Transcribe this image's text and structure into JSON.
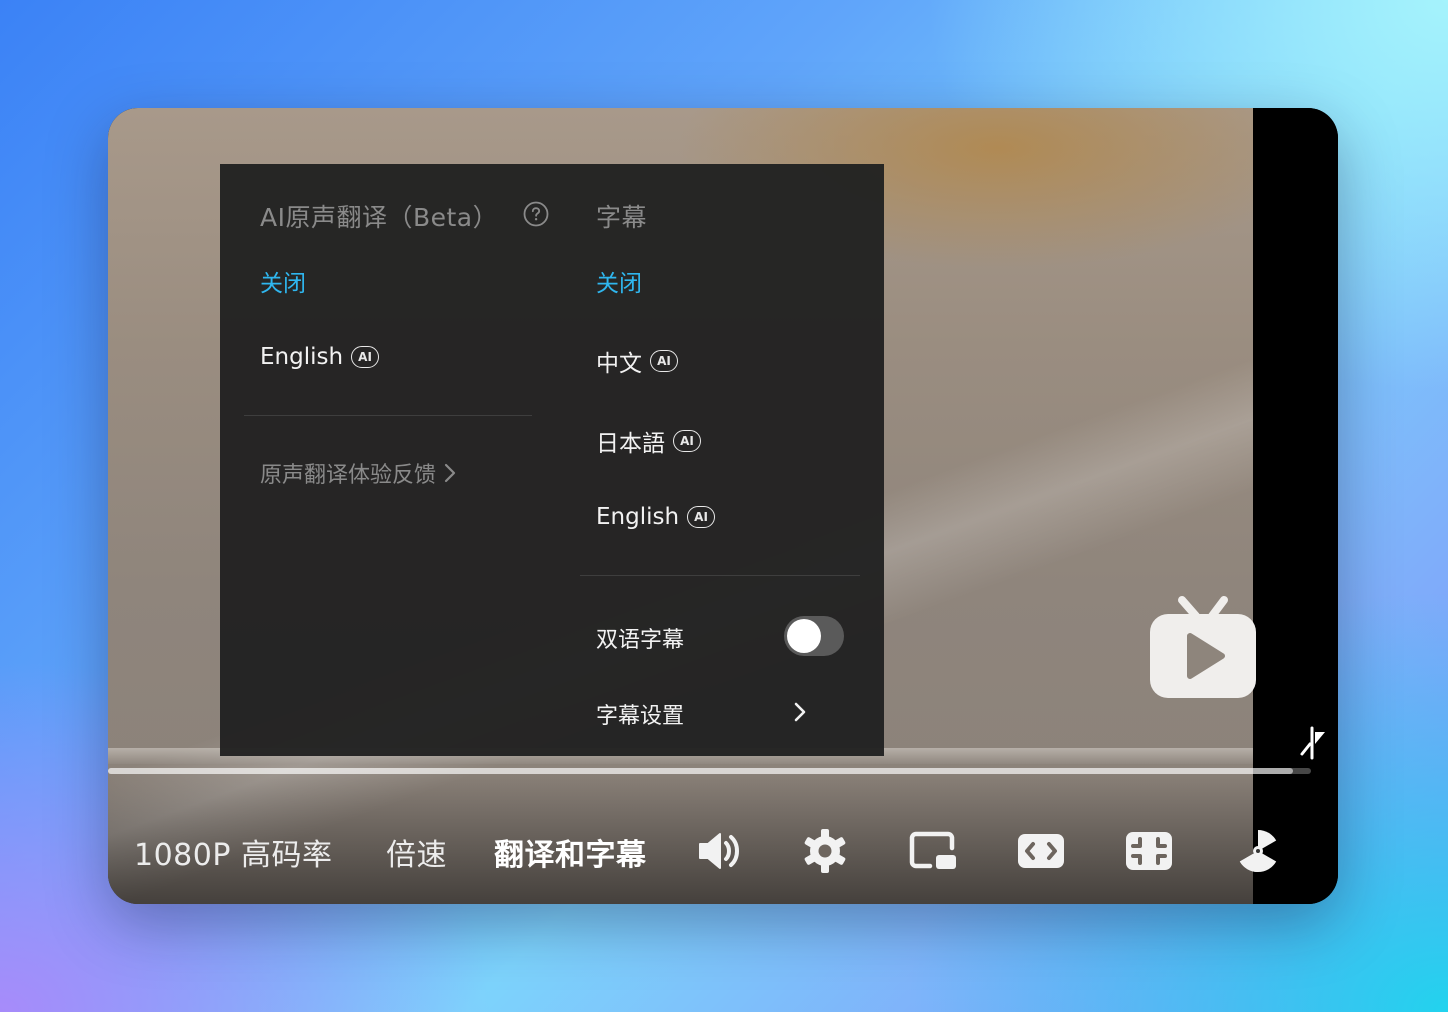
{
  "menu": {
    "ai_translate": {
      "title": "AI原声翻译（Beta）",
      "options": [
        {
          "label": "关闭",
          "active": true,
          "ai": false
        },
        {
          "label": "English",
          "active": false,
          "ai": true
        }
      ],
      "feedback_label": "原声翻译体验反馈"
    },
    "subtitles": {
      "title": "字幕",
      "options": [
        {
          "label": "关闭",
          "active": true,
          "ai": false
        },
        {
          "label": "中文",
          "active": false,
          "ai": true
        },
        {
          "label": "日本語",
          "active": false,
          "ai": true
        },
        {
          "label": "English",
          "active": false,
          "ai": true
        }
      ],
      "bilingual_label": "双语字幕",
      "bilingual_enabled": false,
      "settings_label": "字幕设置"
    },
    "ai_badge_text": "AI"
  },
  "controls": {
    "quality_label": "1080P 高码率",
    "speed_label": "倍速",
    "translate_subtitle_label": "翻译和字幕"
  },
  "progress": {
    "fraction_played": 0.985
  },
  "colors": {
    "accent": "#2fb6ee",
    "menu_bg": "#222222",
    "muted_text": "#8a8a8a"
  },
  "icons": [
    "help-icon",
    "chevron-right-icon",
    "volume-icon",
    "settings-gear-icon",
    "picture-in-picture-icon",
    "widescreen-icon",
    "web-fullscreen-icon",
    "fullscreen-icon",
    "tv-logo-icon",
    "progress-knob-icon"
  ]
}
